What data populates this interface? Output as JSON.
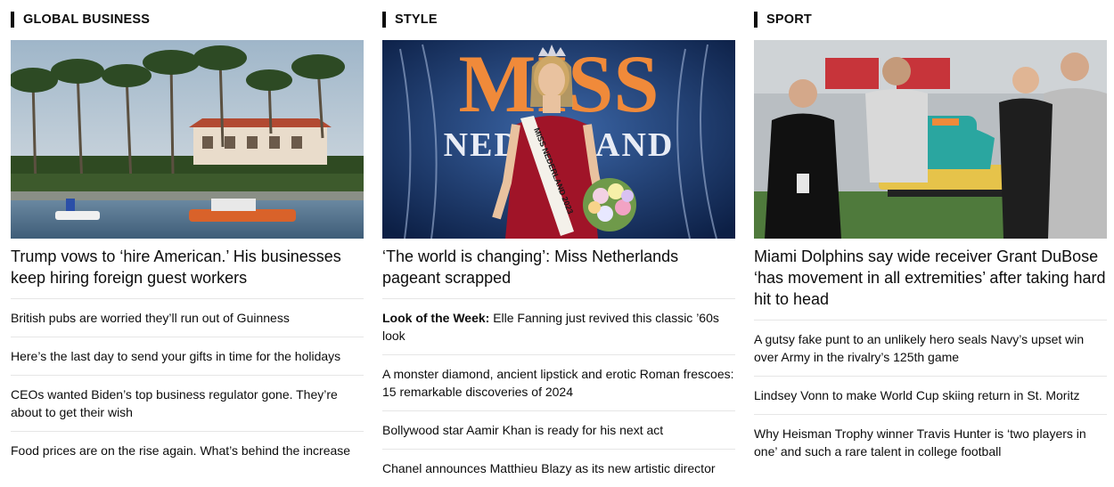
{
  "columns": [
    {
      "section": "GLOBAL BUSINESS",
      "headline": "Trump vows to ‘hire American.’ His businesses keep hiring foreign guest workers",
      "items": [
        {
          "kicker": "",
          "text": "British pubs are worried they’ll run out of Guinness"
        },
        {
          "kicker": "",
          "text": "Here’s the last day to send your gifts in time for the holidays"
        },
        {
          "kicker": "",
          "text": "CEOs wanted Biden’s top business regulator gone. They’re about to get their wish"
        },
        {
          "kicker": "",
          "text": "Food prices are on the rise again. What’s behind the increase"
        }
      ]
    },
    {
      "section": "STYLE",
      "headline": "‘The world is changing’: Miss Netherlands pageant scrapped",
      "image_text": {
        "backdrop_top": "MISS",
        "backdrop_bottom": "NEDERLAND",
        "sash": "MISS NEDERLAND 2023"
      },
      "items": [
        {
          "kicker": "Look of the Week:",
          "text": " Elle Fanning just revived this classic ’60s look"
        },
        {
          "kicker": "",
          "text": "A monster diamond, ancient lipstick and erotic Roman frescoes: 15 remarkable discoveries of 2024"
        },
        {
          "kicker": "",
          "text": "Bollywood star Aamir Khan is ready for his next act"
        },
        {
          "kicker": "",
          "text": "Chanel announces Matthieu Blazy as its new artistic director"
        }
      ]
    },
    {
      "section": "SPORT",
      "headline": "Miami Dolphins say wide receiver Grant DuBose ‘has movement in all extremities’ after taking hard hit to head",
      "items": [
        {
          "kicker": "",
          "text": "A gutsy fake punt to an unlikely hero seals Navy’s upset win over Army in the rivalry’s 125th game"
        },
        {
          "kicker": "",
          "text": "Lindsey Vonn to make World Cup skiing return in St. Moritz"
        },
        {
          "kicker": "",
          "text": "Why Heisman Trophy winner Travis Hunter is ‘two players in one’ and such a rare talent in college football"
        }
      ]
    }
  ],
  "colors": {
    "text": "#0c0c0c",
    "divider": "#e6e6e6",
    "background": "#ffffff"
  }
}
